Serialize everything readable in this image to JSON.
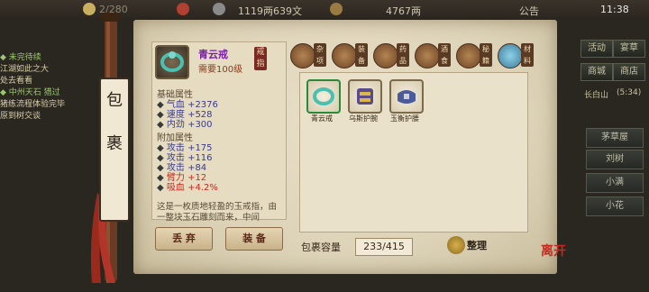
{
  "topbar": {
    "stat1": "2/280",
    "money": "1119两639文",
    "gems": "4767两",
    "announce": "公告",
    "time": "11:38"
  },
  "questlog": {
    "l1": "◆ 未完待续",
    "l2": "江湖如此之大",
    "l3": "处去看看",
    "l4": "◆ 中州天石 猎过",
    "l5": "猪练流程体验完毕",
    "l6": "原到树交谈"
  },
  "menu": {
    "b1": "活动",
    "b2": "宴草",
    "b3": "商城",
    "b4": "商店",
    "loc": "长白山",
    "time2": "(5:34)"
  },
  "sidebar": {
    "s1": "茅草屋",
    "s2": "刘树",
    "s3": "小满",
    "s4": "小花"
  },
  "scroll": {
    "c1": "包",
    "c2": "裹"
  },
  "item": {
    "name": "青云戒",
    "req": "需要100级",
    "tag": "戒指"
  },
  "stats": {
    "base_title": "基础属性",
    "base": [
      {
        "k": "气血",
        "v": "+2376"
      },
      {
        "k": "速度",
        "v": "+528"
      },
      {
        "k": "内劲",
        "v": "+300"
      }
    ],
    "add_title": "附加属性",
    "add": [
      {
        "k": "攻击",
        "v": "+175"
      },
      {
        "k": "攻击",
        "v": "+116"
      },
      {
        "k": "攻击",
        "v": "+84"
      },
      {
        "k": "臂力",
        "v": "+12"
      },
      {
        "k": "吸血",
        "v": "+4.2%"
      }
    ]
  },
  "desc": "这是一枚质地轻盈的玉戒指，由一整块玉石雕刻而来，中间",
  "buttons": {
    "discard": "丢 弃",
    "equip": "装 备"
  },
  "categories": [
    "杂项",
    "装备",
    "药品",
    "酒食",
    "秘籍",
    "材料"
  ],
  "inventory": [
    {
      "label": "青云戒"
    },
    {
      "label": "乌斯护腕"
    },
    {
      "label": "玉衡护腰"
    }
  ],
  "capacity": {
    "label": "包裹容量",
    "value": "233/415"
  },
  "sort_label": "整理",
  "leave_label": "离开",
  "colors": {
    "paper": "#ddd3b8",
    "purple_name": "#7a1fa8",
    "stat_blue": "#3a3a88",
    "red_value": "#c8281e"
  }
}
